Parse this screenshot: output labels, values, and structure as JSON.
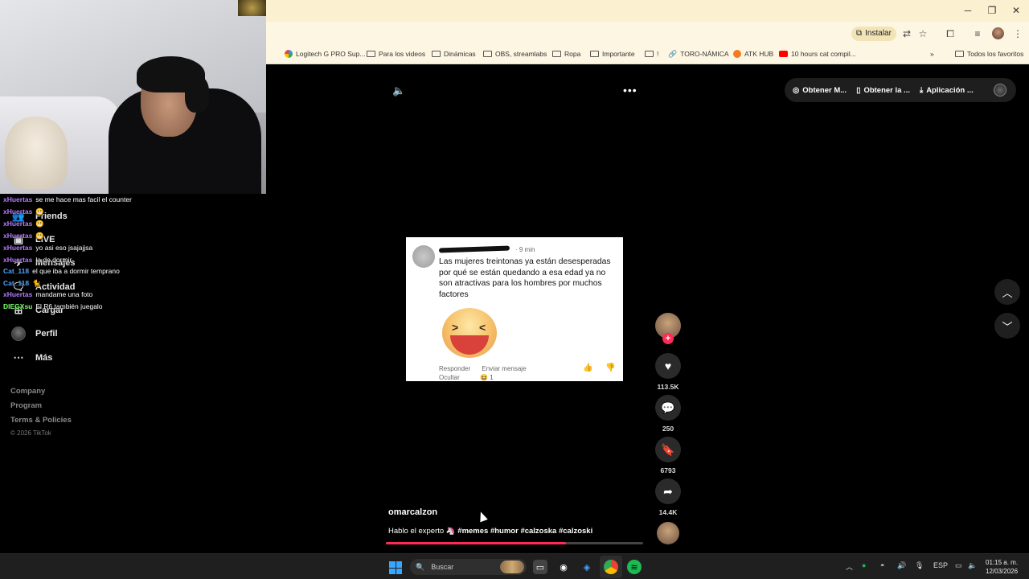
{
  "browser": {
    "install_label": "Instalar",
    "bookmarks": [
      {
        "label": "Logitech G PRO Sup...",
        "icon": "google-icon"
      },
      {
        "label": "Para los videos",
        "icon": "folder-icon"
      },
      {
        "label": "Dinámicas",
        "icon": "folder-icon"
      },
      {
        "label": "OBS, streamlabs",
        "icon": "folder-icon"
      },
      {
        "label": "Ropa",
        "icon": "folder-icon"
      },
      {
        "label": "Importante",
        "icon": "folder-icon"
      },
      {
        "label": "!",
        "icon": "folder-icon"
      },
      {
        "label": "TORO-NÁMICA",
        "icon": "link-icon"
      },
      {
        "label": "ATK HUB",
        "icon": "atk-icon"
      },
      {
        "label": "10 hours cat compil...",
        "icon": "youtube-icon"
      }
    ],
    "all_bookmarks_label": "Todos los favoritos"
  },
  "sidebar": {
    "items": [
      {
        "label": "Friends",
        "icon": "friends-icon"
      },
      {
        "label": "LIVE",
        "icon": "live-icon"
      },
      {
        "label": "Mensajes",
        "icon": "messages-icon"
      },
      {
        "label": "Actividad",
        "icon": "activity-icon"
      },
      {
        "label": "Cargar",
        "icon": "upload-icon"
      },
      {
        "label": "Perfil",
        "icon": "profile-icon"
      },
      {
        "label": "Más",
        "icon": "more-icon"
      }
    ],
    "footer": [
      "Company",
      "Program",
      "Terms & Policies"
    ],
    "copyright": "© 2026 TikTok"
  },
  "chat": [
    {
      "user": "xHuertas",
      "color": "#b57bff",
      "text": "se me hace mas facil el counter"
    },
    {
      "user": "xHuertas",
      "color": "#b57bff",
      "text": "😬"
    },
    {
      "user": "xHuertas",
      "color": "#b57bff",
      "text": "😬"
    },
    {
      "user": "xHuertas",
      "color": "#b57bff",
      "text": "😬"
    },
    {
      "user": "xHuertas",
      "color": "#b57bff",
      "text": "yo asi eso jsajajjsa"
    },
    {
      "user": "xHuertas",
      "color": "#b57bff",
      "text": "la de dormir"
    },
    {
      "user": "Cat_118",
      "color": "#4fa3ff",
      "text": "el que iba a dormir temprano"
    },
    {
      "user": "Cat_118",
      "color": "#4fa3ff",
      "text": "🐈"
    },
    {
      "user": "xHuertas",
      "color": "#b57bff",
      "text": "mandame una foto"
    },
    {
      "user": "DIEGXsu",
      "color": "#7dff6a",
      "text": "El R6 también juegalo"
    }
  ],
  "topbar": {
    "items": [
      "Obtener M...",
      "Obtener la ...",
      "Aplicación ..."
    ]
  },
  "video": {
    "comment_time": "· 9 min",
    "comment_text": "Las mujeres treintonas ya están desesperadas por qué se están quedando a esa edad ya no son atractivas para los hombres por muchos factores",
    "reply_label": "Responder",
    "send_message_label": "Enviar mensaje",
    "hide_label": "Ocultar",
    "reaction_count": "1"
  },
  "actions": {
    "likes": "113.5K",
    "comments": "250",
    "saves": "6793",
    "shares": "14.4K"
  },
  "caption": {
    "username": "omarcalzon",
    "description": "Hablo el experto 🦄",
    "hashtags": "#memes #humor #calzoska #calzoski",
    "progress": 0.7
  },
  "taskbar": {
    "search_placeholder": "Buscar",
    "language": "ESP",
    "time": "01:15 a. m.",
    "date": "12/03/2026"
  }
}
